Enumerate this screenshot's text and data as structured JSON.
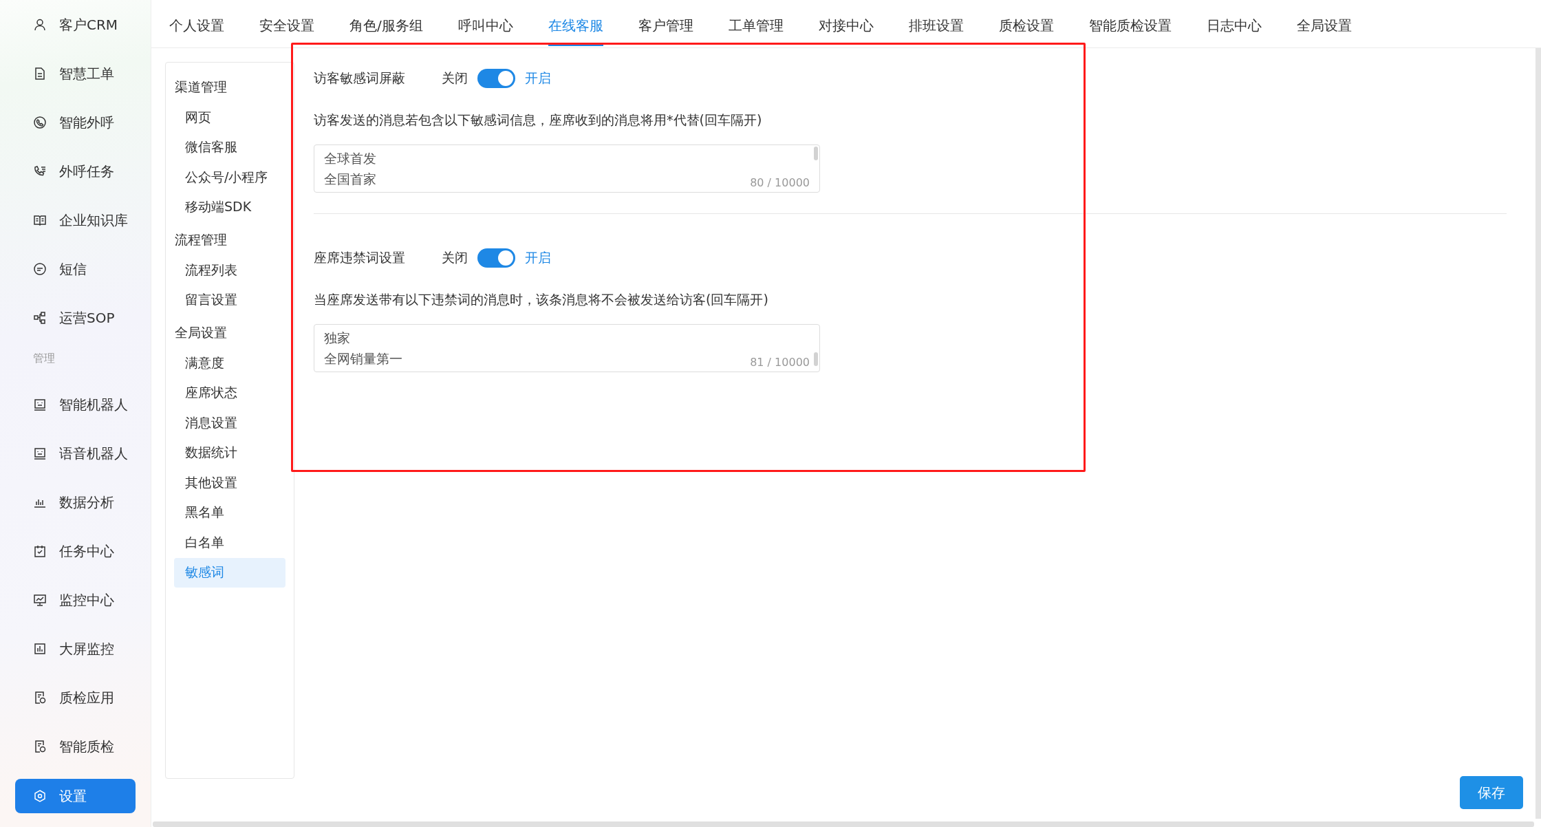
{
  "sidebar": {
    "items": [
      {
        "kind": "item",
        "label": "客户CRM",
        "selected": false
      },
      {
        "kind": "item",
        "label": "智慧工单",
        "selected": false
      },
      {
        "kind": "item",
        "label": "智能外呼",
        "selected": false
      },
      {
        "kind": "item",
        "label": "外呼任务",
        "selected": false
      },
      {
        "kind": "item",
        "label": "企业知识库",
        "selected": false
      },
      {
        "kind": "item",
        "label": "短信",
        "selected": false
      },
      {
        "kind": "item",
        "label": "运营SOP",
        "selected": false
      },
      {
        "kind": "header",
        "label": "管理"
      },
      {
        "kind": "item",
        "label": "智能机器人",
        "selected": false
      },
      {
        "kind": "item",
        "label": "语音机器人",
        "selected": false
      },
      {
        "kind": "item",
        "label": "数据分析",
        "selected": false
      },
      {
        "kind": "item",
        "label": "任务中心",
        "selected": false
      },
      {
        "kind": "item",
        "label": "监控中心",
        "selected": false
      },
      {
        "kind": "item",
        "label": "大屏监控",
        "selected": false
      },
      {
        "kind": "item",
        "label": "质检应用",
        "selected": false
      },
      {
        "kind": "item",
        "label": "智能质检",
        "selected": false
      },
      {
        "kind": "item",
        "label": "设置",
        "selected": true
      }
    ]
  },
  "tabs": [
    {
      "label": "个人设置",
      "selected": false
    },
    {
      "label": "安全设置",
      "selected": false
    },
    {
      "label": "角色/服务组",
      "selected": false
    },
    {
      "label": "呼叫中心",
      "selected": false
    },
    {
      "label": "在线客服",
      "selected": true
    },
    {
      "label": "客户管理",
      "selected": false
    },
    {
      "label": "工单管理",
      "selected": false
    },
    {
      "label": "对接中心",
      "selected": false
    },
    {
      "label": "排班设置",
      "selected": false
    },
    {
      "label": "质检设置",
      "selected": false
    },
    {
      "label": "智能质检设置",
      "selected": false
    },
    {
      "label": "日志中心",
      "selected": false
    },
    {
      "label": "全局设置",
      "selected": false
    }
  ],
  "subnav": [
    {
      "kind": "group",
      "label": "渠道管理"
    },
    {
      "kind": "item",
      "label": "网页",
      "selected": false
    },
    {
      "kind": "item",
      "label": "微信客服",
      "selected": false
    },
    {
      "kind": "item",
      "label": "公众号/小程序",
      "selected": false
    },
    {
      "kind": "item",
      "label": "移动端SDK",
      "selected": false
    },
    {
      "kind": "group",
      "label": "流程管理"
    },
    {
      "kind": "item",
      "label": "流程列表",
      "selected": false
    },
    {
      "kind": "item",
      "label": "留言设置",
      "selected": false
    },
    {
      "kind": "group",
      "label": "全局设置"
    },
    {
      "kind": "item",
      "label": "满意度",
      "selected": false
    },
    {
      "kind": "item",
      "label": "座席状态",
      "selected": false
    },
    {
      "kind": "item",
      "label": "消息设置",
      "selected": false
    },
    {
      "kind": "item",
      "label": "数据统计",
      "selected": false
    },
    {
      "kind": "item",
      "label": "其他设置",
      "selected": false
    },
    {
      "kind": "item",
      "label": "黑名单",
      "selected": false
    },
    {
      "kind": "item",
      "label": "白名单",
      "selected": false
    },
    {
      "kind": "item",
      "label": "敏感词",
      "selected": true
    }
  ],
  "sections": [
    {
      "title": "访客敏感词屏蔽",
      "off_label": "关闭",
      "on_label": "开启",
      "on": true,
      "description": "访客发送的消息若包含以下敏感词信息，座席收到的消息将用*代替(回车隔开)",
      "lines": [
        "全球首发",
        "全国首家"
      ],
      "count": "80 / 10000"
    },
    {
      "title": "座席违禁词设置",
      "off_label": "关闭",
      "on_label": "开启",
      "on": true,
      "description": "当座席发送带有以下违禁词的消息时，该条消息将不会被发送给访客(回车隔开)",
      "lines": [
        "独家",
        "全网销量第一"
      ],
      "count": "81 / 10000"
    }
  ],
  "save_button": "保存"
}
